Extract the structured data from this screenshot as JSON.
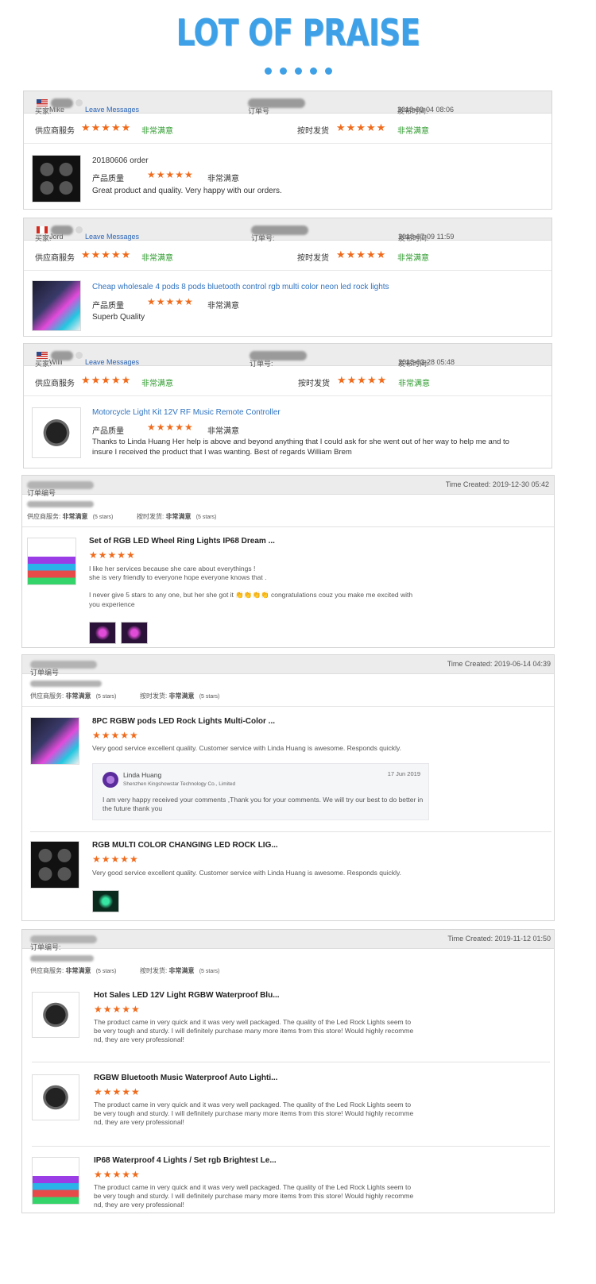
{
  "page_title": "LOT OF PRAISE",
  "colors": {
    "accent": "#3ea0e6",
    "star": "#f06b1c",
    "green_text": "#2c9a2c",
    "link": "#2f73c0"
  },
  "legacy_reviews": [
    {
      "buyer_label": "买家:",
      "buyer_name": "Mike",
      "flag": "us",
      "leave_messages": "Leave Messages",
      "order_label": "订单号",
      "date_label": "发布时间:",
      "date": "2018-09-04 08:06",
      "supplier_label": "供应商服务",
      "supplier_stars": "★★★★★",
      "supplier_rating": "非常满意",
      "shipping_label": "按时发货",
      "shipping_stars": "★★★★★",
      "shipping_rating": "非常满意",
      "product_title": "20180606 order",
      "quality_label": "产品质量",
      "quality_stars": "★★★★★",
      "quality_rating": "非常满意",
      "comment": "Great product and quality. Very happy with our orders."
    },
    {
      "buyer_label": "买家:",
      "buyer_name": "Jord",
      "flag": "ca",
      "leave_messages": "Leave Messages",
      "order_label": "订单号:",
      "date_label": "发布时间:",
      "date": "2018-07-09 11:59",
      "supplier_label": "供应商服务",
      "supplier_stars": "★★★★★",
      "supplier_rating": "非常满意",
      "shipping_label": "按时发货",
      "shipping_stars": "★★★★★",
      "shipping_rating": "非常满意",
      "product_title": "Cheap wholesale 4 pods 8 pods bluetooth control rgb multi color neon led rock lights",
      "quality_label": "产品质量",
      "quality_stars": "★★★★★",
      "quality_rating": "非常满意",
      "comment": "Superb Quality"
    },
    {
      "buyer_label": "买家:",
      "buyer_name": "Willi",
      "flag": "us",
      "leave_messages": "Leave Messages",
      "order_label": "订单号:",
      "date_label": "发布时间:",
      "date": "2018-03-28 05:48",
      "supplier_label": "供应商服务",
      "supplier_stars": "★★★★★",
      "supplier_rating": "非常满意",
      "shipping_label": "按时发货",
      "shipping_stars": "★★★★★",
      "shipping_rating": "非常满意",
      "product_title": "Motorcycle Light Kit 12V RF Music Remote Controller",
      "quality_label": "产品质量",
      "quality_stars": "★★★★★",
      "quality_rating": "非常满意",
      "comment_line1": "Thanks to Linda Huang Her help is above and beyond anything that I could ask for she went out of her way to help me and to",
      "comment_line2": "insure I received the product that I was wanting. Best of regards William Brem"
    }
  ],
  "order_reviews": [
    {
      "order_label": "订单编号",
      "time_created": "Time Created: 2019-12-30 05:42",
      "supplier_label": "供应商服务:",
      "supplier_rating": "非常满意",
      "supplier_stars_text": "(5 stars)",
      "shipping_label": "按时发货:",
      "shipping_rating": "非常满意",
      "shipping_stars_text": "(5 stars)",
      "items": [
        {
          "title": "Set of RGB LED Wheel Ring Lights IP68 Dream ...",
          "stars": "★★★★★",
          "lines": [
            "I like her services because she care about everythings !",
            "she is very friendly to everyone hope everyone knows that .",
            "",
            "I never give 5 stars to any one, but her she  got it 👏👏👏👏 congratulations  couz you make me excited with",
            "you experience"
          ]
        }
      ]
    },
    {
      "order_label": "订单编号",
      "time_created": "Time Created: 2019-06-14 04:39",
      "supplier_label": "供应商服务:",
      "supplier_rating": "非常满意",
      "supplier_stars_text": "(5 stars)",
      "shipping_label": "按时发货:",
      "shipping_rating": "非常满意",
      "shipping_stars_text": "(5 stars)",
      "items": [
        {
          "title": "8PC RGBW pods LED Rock Lights Multi-Color ...",
          "stars": "★★★★★",
          "lines": [
            "Very good service excellent quality. Customer service with Linda Huang is awesome.  Responds quickly."
          ],
          "reply": {
            "name": "Linda Huang",
            "company": "Shenzhen Kingshowstar Technology Co., Limited",
            "date": "17 Jun 2019",
            "line1": "I am very happy received your comments ,Thank you for your comments. We will try our best to do better in",
            "line2": "the future thank you"
          }
        },
        {
          "title": "RGB MULTI COLOR CHANGING LED ROCK LIG...",
          "stars": "★★★★★",
          "lines": [
            "Very good service excellent quality. Customer service with Linda Huang is awesome.  Responds quickly."
          ]
        }
      ]
    },
    {
      "order_label": "订单编号:",
      "time_created": "Time Created: 2019-11-12 01:50",
      "supplier_label": "供应商服务:",
      "supplier_rating": "非常满意",
      "supplier_stars_text": "(5 stars)",
      "shipping_label": "按时发货:",
      "shipping_rating": "非常满意",
      "shipping_stars_text": "(5 stars)",
      "items": [
        {
          "title": "Hot Sales LED 12V Light RGBW Waterproof Blu...",
          "stars": "★★★★★",
          "lines": [
            "The product came in very quick and it was very well packaged. The quality of the Led Rock Lights seem to",
            "be very tough and sturdy. I will definitely purchase many more items from this store! Would highly recomme",
            "nd, they are very professional!"
          ]
        },
        {
          "title": "RGBW Bluetooth Music Waterproof Auto Lighti...",
          "stars": "★★★★★",
          "lines": [
            "The product came in very quick and it was very well packaged. The quality of the Led Rock Lights seem to",
            "be very tough and sturdy. I will definitely purchase many more items from this store! Would highly recomme",
            "nd, they are very professional!"
          ]
        },
        {
          "title": "IP68 Waterproof 4 Lights / Set rgb Brightest Le...",
          "stars": "★★★★★",
          "lines": [
            "The product came in very quick and it was very well packaged. The quality of the Led Rock Lights seem to",
            "be very tough and sturdy. I will definitely purchase many more items from this store! Would highly recomme",
            "nd, they are very professional!"
          ]
        }
      ]
    }
  ]
}
